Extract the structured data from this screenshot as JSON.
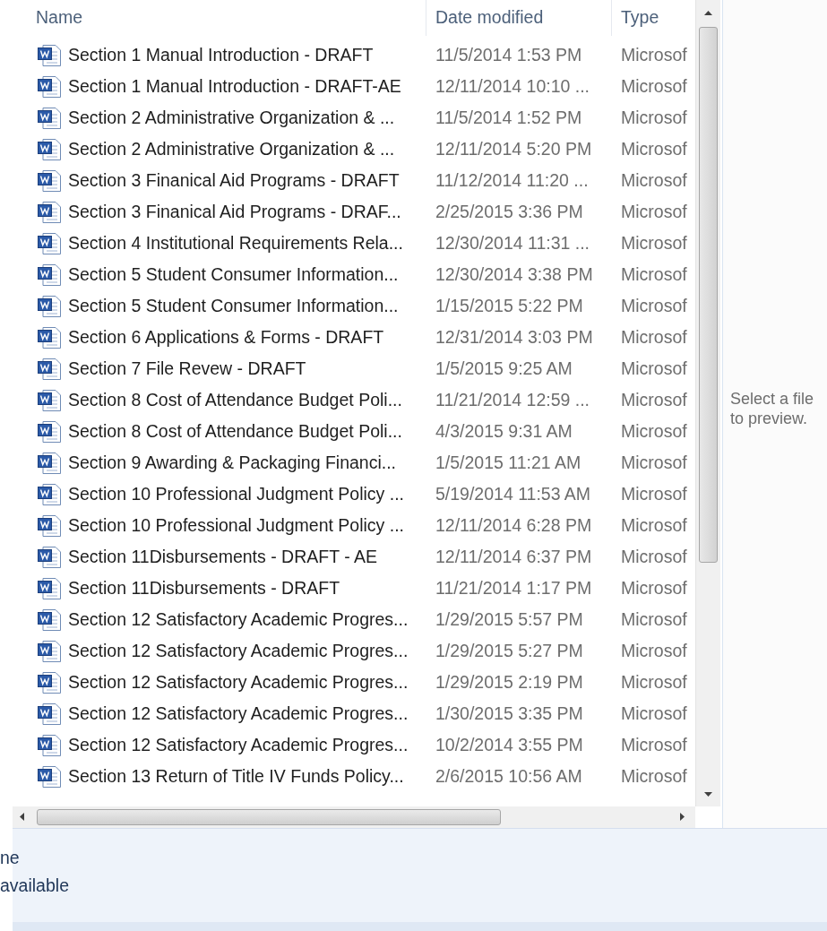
{
  "columns": [
    {
      "label": "Name"
    },
    {
      "label": "Date modified"
    },
    {
      "label": "Type"
    }
  ],
  "files": [
    {
      "name": "Section 1 Manual Introduction - DRAFT",
      "date": "11/5/2014 1:53 PM",
      "type": "Microsof"
    },
    {
      "name": "Section 1 Manual Introduction - DRAFT-AE",
      "date": "12/11/2014 10:10 ...",
      "type": "Microsof"
    },
    {
      "name": "Section 2 Administrative Organization & ...",
      "date": "11/5/2014 1:52 PM",
      "type": "Microsof"
    },
    {
      "name": "Section 2 Administrative Organization & ...",
      "date": "12/11/2014 5:20 PM",
      "type": "Microsof"
    },
    {
      "name": "Section 3 Finanical Aid Programs - DRAFT",
      "date": "11/12/2014 11:20 ...",
      "type": "Microsof"
    },
    {
      "name": "Section 3 Finanical Aid Programs - DRAF...",
      "date": "2/25/2015 3:36 PM",
      "type": "Microsof"
    },
    {
      "name": "Section 4 Institutional Requirements Rela...",
      "date": "12/30/2014 11:31 ...",
      "type": "Microsof"
    },
    {
      "name": "Section 5 Student Consumer Information...",
      "date": "12/30/2014 3:38 PM",
      "type": "Microsof"
    },
    {
      "name": "Section 5 Student Consumer Information...",
      "date": "1/15/2015 5:22 PM",
      "type": "Microsof"
    },
    {
      "name": "Section 6 Applications & Forms - DRAFT",
      "date": "12/31/2014 3:03 PM",
      "type": "Microsof"
    },
    {
      "name": "Section 7 File Revew - DRAFT",
      "date": "1/5/2015 9:25 AM",
      "type": "Microsof"
    },
    {
      "name": "Section 8 Cost of Attendance Budget Poli...",
      "date": "11/21/2014 12:59 ...",
      "type": "Microsof"
    },
    {
      "name": "Section 8 Cost of Attendance Budget Poli...",
      "date": "4/3/2015 9:31 AM",
      "type": "Microsof"
    },
    {
      "name": "Section 9 Awarding & Packaging Financi...",
      "date": "1/5/2015 11:21 AM",
      "type": "Microsof"
    },
    {
      "name": "Section 10 Professional Judgment Policy ...",
      "date": "5/19/2014 11:53 AM",
      "type": "Microsof"
    },
    {
      "name": "Section 10 Professional Judgment Policy ...",
      "date": "12/11/2014 6:28 PM",
      "type": "Microsof"
    },
    {
      "name": "Section 11Disbursements - DRAFT - AE",
      "date": "12/11/2014 6:37 PM",
      "type": "Microsof"
    },
    {
      "name": "Section 11Disbursements - DRAFT",
      "date": "11/21/2014 1:17 PM",
      "type": "Microsof"
    },
    {
      "name": "Section 12 Satisfactory Academic Progres...",
      "date": "1/29/2015 5:57 PM",
      "type": "Microsof"
    },
    {
      "name": "Section 12 Satisfactory Academic Progres...",
      "date": "1/29/2015 5:27 PM",
      "type": "Microsof"
    },
    {
      "name": "Section 12 Satisfactory Academic Progres...",
      "date": "1/29/2015 2:19 PM",
      "type": "Microsof"
    },
    {
      "name": "Section 12 Satisfactory Academic Progres...",
      "date": "1/30/2015 3:35 PM",
      "type": "Microsof"
    },
    {
      "name": "Section 12 Satisfactory Academic Progres...",
      "date": "10/2/2014 3:55 PM",
      "type": "Microsof"
    },
    {
      "name": "Section 13 Return of Title IV Funds Policy...",
      "date": "2/6/2015 10:56 AM",
      "type": "Microsof"
    }
  ],
  "preview": {
    "message": "Select a file to preview."
  },
  "details": {
    "lines": [
      "ne",
      "available"
    ]
  }
}
